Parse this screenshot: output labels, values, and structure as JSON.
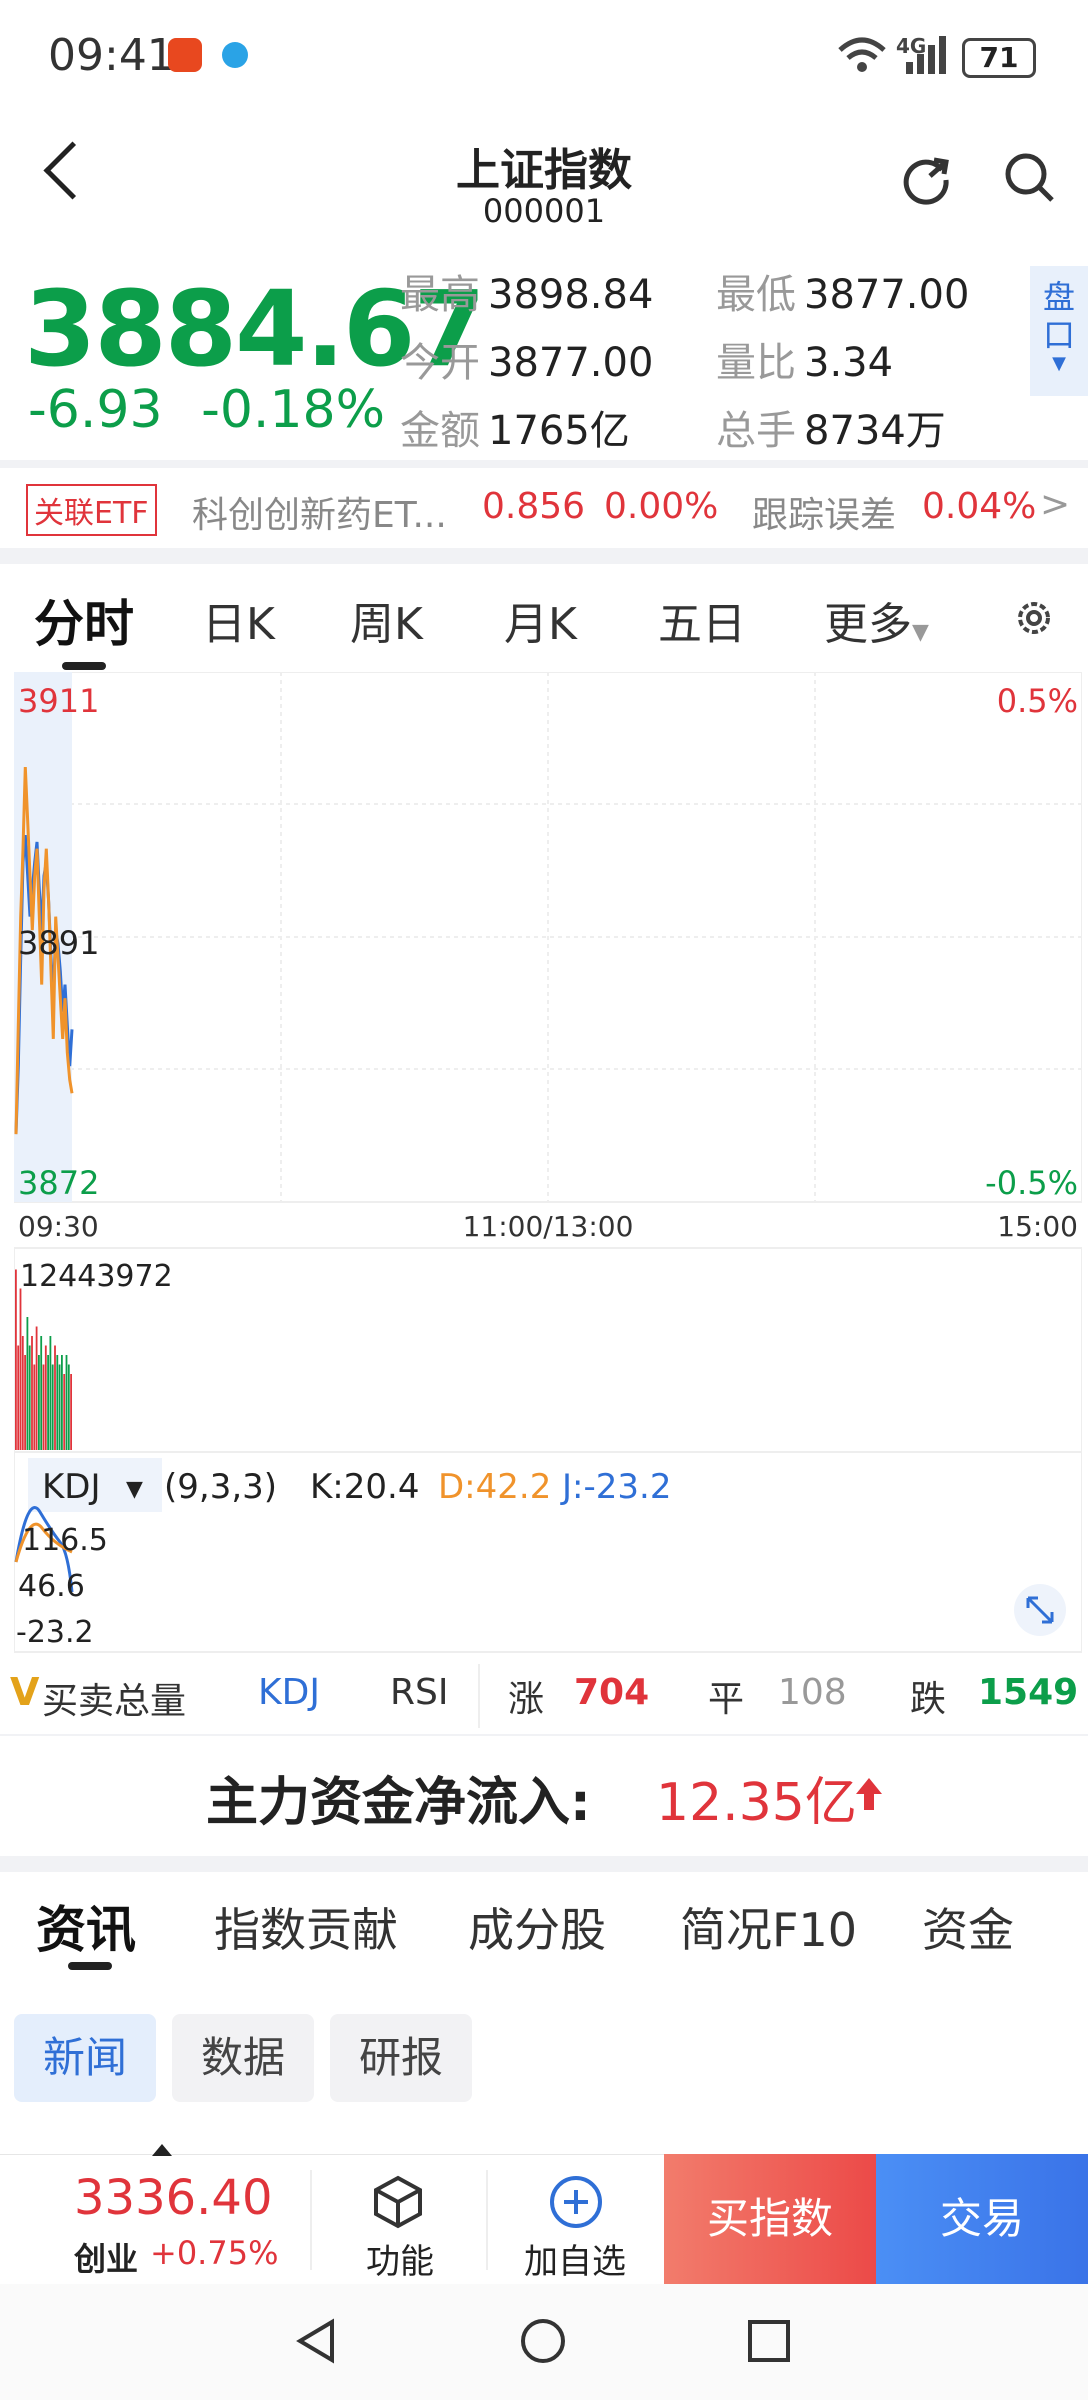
{
  "status_bar": {
    "time": "09:41",
    "battery": "71",
    "network": "4G",
    "icons": [
      "taobao-app-icon",
      "blue-app-icon",
      "wifi-icon",
      "signal-icon",
      "battery-icon"
    ]
  },
  "header": {
    "title": "上证指数",
    "code": "000001"
  },
  "quote": {
    "price": "3884.67",
    "change": "-6.93",
    "change_pct": "-0.18%",
    "high_label": "最高",
    "high": "3898.84",
    "low_label": "最低",
    "low": "3877.00",
    "open_label": "今开",
    "open": "3877.00",
    "ratio_label": "量比",
    "ratio": "3.34",
    "amount_label": "金额",
    "amount": "1765亿",
    "turnover_label": "总手",
    "turnover": "8734万",
    "pankou_line1": "盘",
    "pankou_line2": "口"
  },
  "etf": {
    "tag": "关联ETF",
    "name": "科创创新药ET...",
    "price": "0.856",
    "pct": "0.00%",
    "track_label": "跟踪误差",
    "track_value": "0.04%"
  },
  "kline_tabs": [
    "分时",
    "日K",
    "周K",
    "月K",
    "五日",
    "更多"
  ],
  "chart": {
    "y_top": "3911",
    "y_mid": "3891",
    "y_bottom": "3872",
    "pct_top": "0.5%",
    "pct_bottom": "-0.5%",
    "x_start": "09:30",
    "x_mid": "11:00/13:00",
    "x_end": "15:00",
    "volume_label": "12443972",
    "indicator": "KDJ",
    "indicator_params": "(9,3,3)",
    "k_text": "K:20.4",
    "d_text": "D:42.2",
    "j_text": "J:-23.2",
    "kdj_v1": "116.5",
    "kdj_v2": "46.6",
    "kdj_v3": "-23.2"
  },
  "chart_data": {
    "type": "line",
    "title": "",
    "xlabel": "",
    "ylabel": "",
    "ylim": [
      3872,
      3911
    ],
    "x": [
      0,
      1,
      2,
      3,
      4,
      5,
      6,
      7,
      8,
      9,
      10,
      11,
      12,
      13,
      14,
      15,
      16,
      17,
      18,
      19,
      20,
      21,
      22,
      23,
      24
    ],
    "series": [
      {
        "values": [
          3877.0,
          3882,
          3890,
          3897,
          3899,
          3896,
          3893,
          3895,
          3897,
          3898.5,
          3895,
          3892,
          3896,
          3897,
          3894,
          3890,
          3887,
          3892,
          3891,
          3889,
          3886,
          3888,
          3885,
          3882,
          3884.7
        ],
        "color": "#2f6fd6"
      },
      {
        "values": [
          3877.0,
          3885,
          3893,
          3898,
          3904,
          3900,
          3896,
          3892,
          3896,
          3898,
          3893,
          3888,
          3895,
          3898,
          3894,
          3889,
          3884,
          3893,
          3890,
          3887,
          3884,
          3887,
          3883,
          3881,
          3880
        ],
        "color": "#f0932b"
      }
    ]
  },
  "volume_data": {
    "values": [
      0.95,
      0.55,
      0.85,
      0.6,
      0.5,
      0.7,
      0.55,
      0.6,
      0.45,
      0.65,
      0.5,
      0.6,
      0.45,
      0.55,
      0.5,
      0.6,
      0.45,
      0.55,
      0.5,
      0.45,
      0.5,
      0.4,
      0.5,
      0.45,
      0.4
    ]
  },
  "market_breadth": {
    "tab_total": "买卖总量",
    "tab_kdj": "KDJ",
    "tab_rsi": "RSI",
    "up_label": "涨",
    "up": "704",
    "flat_label": "平",
    "flat": "108",
    "down_label": "跌",
    "down": "1549"
  },
  "fund_flow": {
    "label": "主力资金净流入:",
    "value": "12.35亿"
  },
  "news_tabs": [
    "资讯",
    "指数贡献",
    "成分股",
    "简况F10",
    "资金"
  ],
  "news_chips": [
    "新闻",
    "数据",
    "研报"
  ],
  "bottom_bar": {
    "ticker_price": "3336.40",
    "ticker_name": "创业",
    "ticker_pct": "+0.75%",
    "function_label": "功能",
    "add_label": "加自选",
    "buy_label": "买指数",
    "trade_label": "交易"
  },
  "colors": {
    "down": "#0c9e4a",
    "up": "#e0343b",
    "accent": "#2f6fd6",
    "orange": "#f0932b"
  }
}
